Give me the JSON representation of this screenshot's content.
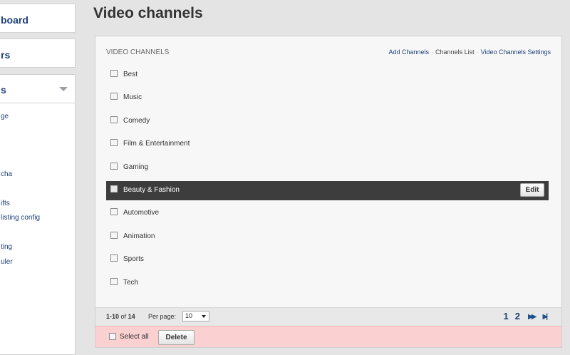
{
  "sidebar": {
    "boxes": [
      {
        "label": "board"
      },
      {
        "label": "rs"
      },
      {
        "label": "s"
      }
    ],
    "sub_items": [
      {
        "label": "ge"
      },
      {
        "label": "cha"
      },
      {
        "label": "ifts"
      },
      {
        "label": "listing config"
      },
      {
        "label": "ting"
      },
      {
        "label": "uler"
      }
    ]
  },
  "page": {
    "title": "Video channels"
  },
  "panel": {
    "heading": "VIDEO CHANNELS",
    "links": {
      "add": "Add Channels",
      "sep": "·",
      "list": "Channels List",
      "settings": "Video Channels Settings"
    },
    "rows": [
      {
        "name": "Best"
      },
      {
        "name": "Music"
      },
      {
        "name": "Comedy"
      },
      {
        "name": "Film & Entertainment"
      },
      {
        "name": "Gaming"
      },
      {
        "name": "Beauty & Fashion"
      },
      {
        "name": "Automotive"
      },
      {
        "name": "Animation"
      },
      {
        "name": "Sports"
      },
      {
        "name": "Tech"
      }
    ],
    "edit_label": "Edit"
  },
  "pager": {
    "range": "1-10",
    "of_label": "of",
    "total": "14",
    "per_page_label": "Per page:",
    "per_page_value": "10",
    "pages": [
      "1",
      "2"
    ],
    "next_icon": "fast-forward-icon",
    "last_icon": "skip-to-last-icon"
  },
  "actions": {
    "select_all_label": "Select all",
    "delete_label": "Delete"
  },
  "colors": {
    "link": "#1d3f7a",
    "active_row": "#3d3d3d",
    "action_bar": "#fbd0d0"
  }
}
